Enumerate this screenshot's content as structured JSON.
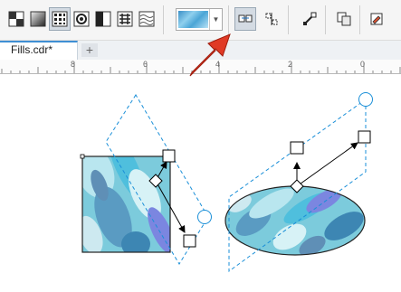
{
  "toolbar": {
    "tools": [
      {
        "name": "no-fill-icon"
      },
      {
        "name": "uniform-fill-icon"
      },
      {
        "name": "pattern-fill-icon"
      },
      {
        "name": "postscript-fill-icon"
      },
      {
        "name": "two-color-fill-icon"
      },
      {
        "name": "texture-fill-icon"
      },
      {
        "name": "wave-fill-icon"
      },
      {
        "name": "fill-picker-icon"
      },
      {
        "name": "transform-with-object-icon"
      },
      {
        "name": "mirror-tiles-icon"
      },
      {
        "name": "edit-fill-icon"
      },
      {
        "name": "copy-fill-icon"
      },
      {
        "name": "fill-properties-icon"
      }
    ],
    "fill_picker": {
      "swatch": "texture-swatch"
    }
  },
  "tabs": {
    "document": "Fills.cdr*",
    "new_tab": "+"
  },
  "ruler": {
    "labels": [
      "8",
      "6",
      "4",
      "2",
      "0"
    ]
  },
  "colors": {
    "accent": "#3f8fd4",
    "pointer_arrow": "#e03a25",
    "handle_line": "#1a8fd8"
  }
}
